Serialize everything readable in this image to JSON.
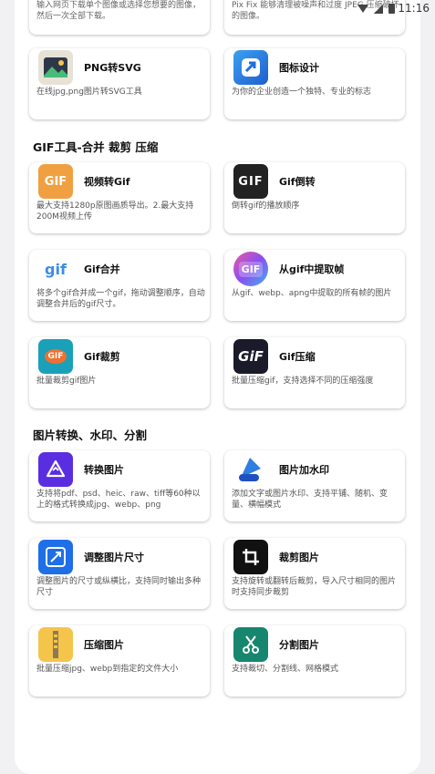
{
  "status": {
    "time": "11:16"
  },
  "top_partial": {
    "left_text": "输入网页下载单个图像或选择您想要的图像，然后一次全部下载。",
    "right_text": "Pix Fix 能够清理被噪声和过度 JPEG 压缩破坏的图像。"
  },
  "cards_top": [
    {
      "title": "PNG转SVG",
      "desc": "在线jpg,png图片转SVG工具",
      "icon": "png-svg-icon",
      "color": "#e8e0d0"
    },
    {
      "title": "图标设计",
      "desc": "为你的企业创造一个独特、专业的标志",
      "icon": "logo-design-icon",
      "color": "#2f7fe0"
    }
  ],
  "sections": [
    {
      "title": "GIF工具-合并 裁剪 压缩"
    },
    {
      "title": "图片转换、水印、分割"
    }
  ],
  "gif_cards": [
    {
      "title": "视频转Gif",
      "desc": "最大支持1280p原图画质导出。2.最大支持200M视频上传",
      "icon_text": "GIF",
      "color": "#f0a040"
    },
    {
      "title": "Gif倒转",
      "desc": "倒转gif的播放顺序",
      "icon_text": "GIF",
      "color": "#222222"
    },
    {
      "title": "Gif合并",
      "desc": "将多个gif合并成一个gif，拖动调整顺序，自动调整合并后的gif尺寸。",
      "icon_text": "gif",
      "color": "#ffffff"
    },
    {
      "title": "从gif中提取帧",
      "desc": "从gif、webp、apng中提取的所有帧的图片",
      "icon_text": "GIF",
      "color": "#c050e0"
    },
    {
      "title": "Gif裁剪",
      "desc": "批量裁剪gif图片",
      "icon_text": "GIF",
      "color": "#1aa0b8"
    },
    {
      "title": "Gif压缩",
      "desc": "批量压缩gif，支持选择不同的压缩强度",
      "icon_text": "GiF",
      "color": "#1a1a2a"
    }
  ],
  "image_cards": [
    {
      "title": "转换图片",
      "desc": "支持将pdf、psd、heic、raw、tiff等60种以上的格式转换成jpg、webp、png",
      "icon": "convert-image-icon",
      "color": "#5a2ee0"
    },
    {
      "title": "图片加水印",
      "desc": "添加文字或图片水印、支持平铺、随机、变量、横幅模式",
      "icon": "watermark-icon",
      "color": "#2f7fe0"
    },
    {
      "title": "调整图片尺寸",
      "desc": "调整图片的尺寸或纵横比，支持同时输出多种尺寸",
      "icon": "resize-image-icon",
      "color": "#1e6fe8"
    },
    {
      "title": "裁剪图片",
      "desc": "支持旋转或翻转后裁剪，导入尺寸相同的图片时支持同步裁剪",
      "icon": "crop-image-icon",
      "color": "#111111"
    },
    {
      "title": "压缩图片",
      "desc": "批量压缩jpg、webp到指定的文件大小",
      "icon": "compress-image-icon",
      "color": "#f5c44a"
    },
    {
      "title": "分割图片",
      "desc": "支持裁切、分割线、网格模式",
      "icon": "split-image-icon",
      "color": "#17866e"
    }
  ]
}
